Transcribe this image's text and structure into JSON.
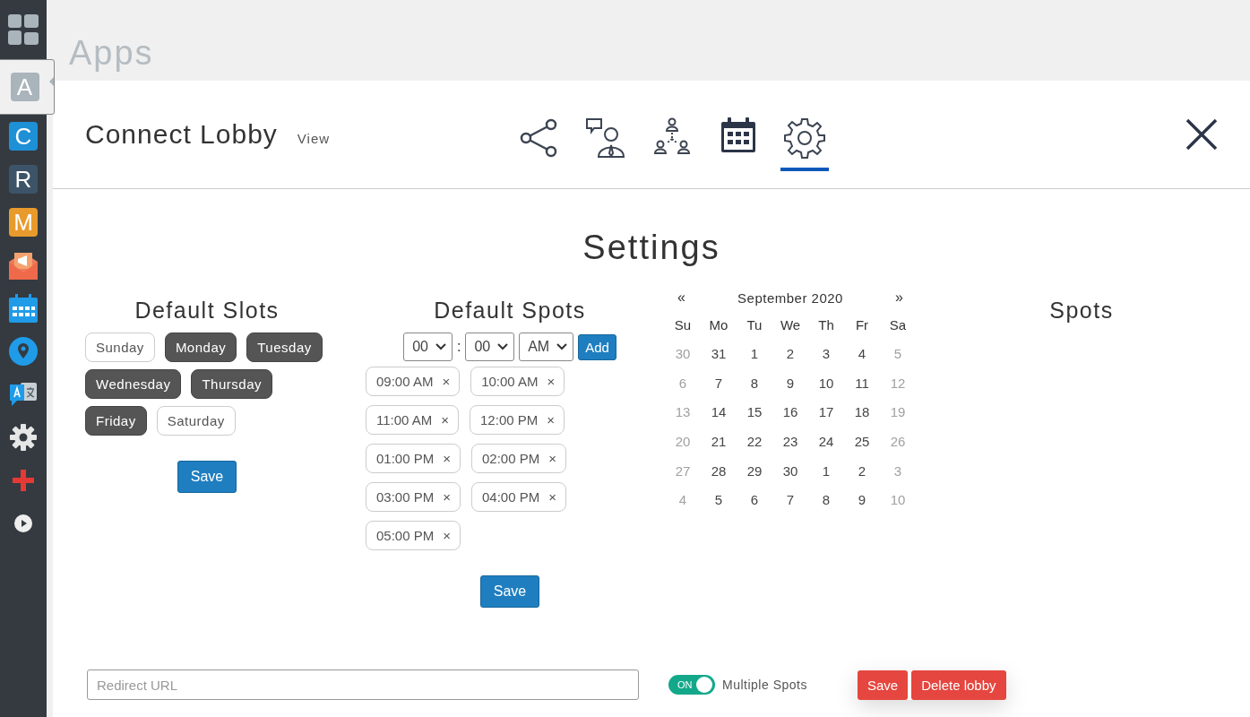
{
  "sidebar": {
    "items": [
      {
        "kind": "grid",
        "selected": false
      },
      {
        "kind": "letter",
        "label": "A",
        "color": "#a9b4bb",
        "selected": true
      },
      {
        "kind": "letter",
        "label": "C",
        "color": "#1e90d6",
        "selected": false
      },
      {
        "kind": "letter",
        "label": "R",
        "color": "#3d5468",
        "selected": false
      },
      {
        "kind": "letter",
        "label": "M",
        "color": "#e99a2c",
        "selected": false
      },
      {
        "kind": "mail",
        "selected": false
      },
      {
        "kind": "calendar",
        "selected": false
      },
      {
        "kind": "pin",
        "selected": false
      },
      {
        "kind": "translate",
        "selected": false
      },
      {
        "kind": "gear",
        "selected": false
      },
      {
        "kind": "plus",
        "selected": false
      },
      {
        "kind": "play",
        "selected": false
      }
    ]
  },
  "page_title": "Apps",
  "panel": {
    "title": "Connect Lobby",
    "view_link": "View",
    "tabs": [
      {
        "kind": "share",
        "selected": false
      },
      {
        "kind": "agent",
        "selected": false
      },
      {
        "kind": "network",
        "selected": false
      },
      {
        "kind": "calendar",
        "selected": false
      },
      {
        "kind": "gear",
        "selected": true
      }
    ]
  },
  "heading": "Settings",
  "default_slots": {
    "title": "Default Slots",
    "days": [
      {
        "label": "Sunday",
        "selected": false
      },
      {
        "label": "Monday",
        "selected": true
      },
      {
        "label": "Tuesday",
        "selected": true
      },
      {
        "label": "Wednesday",
        "selected": true
      },
      {
        "label": "Thursday",
        "selected": true
      },
      {
        "label": "Friday",
        "selected": true
      },
      {
        "label": "Saturday",
        "selected": false
      }
    ],
    "save": "Save"
  },
  "default_spots": {
    "title": "Default Spots",
    "hour": "00",
    "separator": ":",
    "minute": "00",
    "meridiem": "AM",
    "add": "Add",
    "times": [
      {
        "label": "09:00 AM",
        "remove": "×"
      },
      {
        "label": "10:00 AM",
        "remove": "×"
      },
      {
        "label": "11:00 AM",
        "remove": "×"
      },
      {
        "label": "12:00 PM",
        "remove": "×"
      },
      {
        "label": "01:00 PM",
        "remove": "×"
      },
      {
        "label": "02:00 PM",
        "remove": "×"
      },
      {
        "label": "03:00 PM",
        "remove": "×"
      },
      {
        "label": "04:00 PM",
        "remove": "×"
      },
      {
        "label": "05:00 PM",
        "remove": "×"
      }
    ],
    "save": "Save"
  },
  "calendar": {
    "prev": "«",
    "month": "September 2020",
    "next": "»",
    "weekdays": [
      "Su",
      "Mo",
      "Tu",
      "We",
      "Th",
      "Fr",
      "Sa"
    ],
    "weeks": [
      [
        {
          "day": "30",
          "muted": true
        },
        {
          "day": "31",
          "muted": false
        },
        {
          "day": "1",
          "muted": false
        },
        {
          "day": "2",
          "muted": false
        },
        {
          "day": "3",
          "muted": false
        },
        {
          "day": "4",
          "muted": false
        },
        {
          "day": "5",
          "muted": true
        }
      ],
      [
        {
          "day": "6",
          "muted": true
        },
        {
          "day": "7",
          "muted": false
        },
        {
          "day": "8",
          "muted": false
        },
        {
          "day": "9",
          "muted": false
        },
        {
          "day": "10",
          "muted": false
        },
        {
          "day": "11",
          "muted": false
        },
        {
          "day": "12",
          "muted": true
        }
      ],
      [
        {
          "day": "13",
          "muted": true
        },
        {
          "day": "14",
          "muted": false
        },
        {
          "day": "15",
          "muted": false
        },
        {
          "day": "16",
          "muted": false
        },
        {
          "day": "17",
          "muted": false
        },
        {
          "day": "18",
          "muted": false
        },
        {
          "day": "19",
          "muted": true
        }
      ],
      [
        {
          "day": "20",
          "muted": true
        },
        {
          "day": "21",
          "muted": false
        },
        {
          "day": "22",
          "muted": false
        },
        {
          "day": "23",
          "muted": false
        },
        {
          "day": "24",
          "muted": false
        },
        {
          "day": "25",
          "muted": false
        },
        {
          "day": "26",
          "muted": true
        }
      ],
      [
        {
          "day": "27",
          "muted": true
        },
        {
          "day": "28",
          "muted": false
        },
        {
          "day": "29",
          "muted": false
        },
        {
          "day": "30",
          "muted": false
        },
        {
          "day": "1",
          "muted": false
        },
        {
          "day": "2",
          "muted": false
        },
        {
          "day": "3",
          "muted": true
        }
      ],
      [
        {
          "day": "4",
          "muted": true
        },
        {
          "day": "5",
          "muted": false
        },
        {
          "day": "6",
          "muted": false
        },
        {
          "day": "7",
          "muted": false
        },
        {
          "day": "8",
          "muted": false
        },
        {
          "day": "9",
          "muted": false
        },
        {
          "day": "10",
          "muted": true
        }
      ]
    ]
  },
  "spots": {
    "title": "Spots"
  },
  "footer": {
    "redirect_placeholder": "Redirect URL",
    "toggle": {
      "on": true,
      "label": "ON"
    },
    "toggle_caption": "Multiple Spots",
    "save": "Save",
    "delete": "Delete lobby"
  }
}
